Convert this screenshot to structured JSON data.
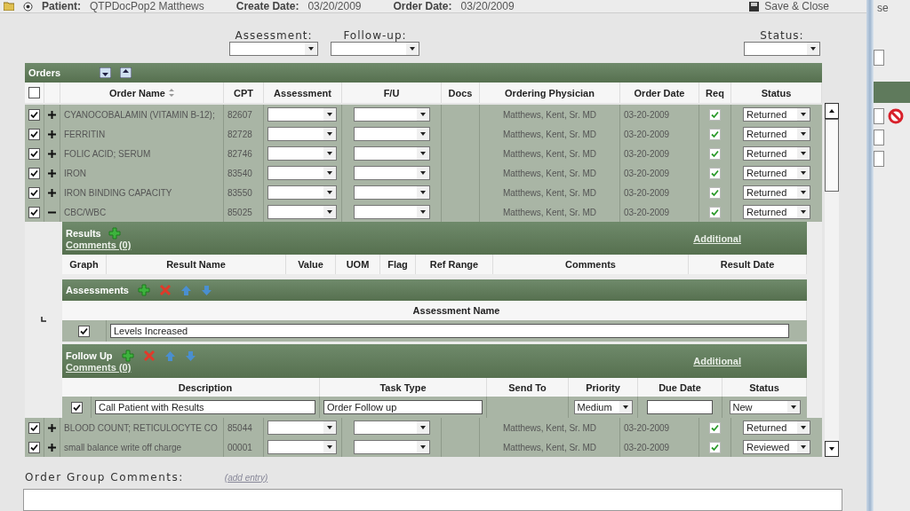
{
  "header": {
    "patient_label": "Patient:",
    "patient": "QTPDocPop2 Matthews",
    "create_date_label": "Create Date:",
    "create_date": "03/20/2009",
    "order_date_label": "Order Date:",
    "order_date": "03/20/2009",
    "save_button": "Save & Close"
  },
  "filters": [
    {
      "label": "Assessment:"
    },
    {
      "label": "Follow-up:"
    },
    {
      "label": "Status:"
    }
  ],
  "orders": {
    "title": "Orders",
    "select_all_checked": false,
    "columns": [
      "Order Name",
      "CPT",
      "Assessment",
      "F/U",
      "Docs",
      "Ordering Physician",
      "Order Date",
      "Req",
      "Status"
    ],
    "rows": [
      {
        "checked": true,
        "expanded": false,
        "name": "CYANOCOBALAMIN (VITAMIN B-12);",
        "cpt": "82607",
        "physician": "Matthews, Kent, Sr. MD",
        "order_date": "03-20-2009",
        "required": true,
        "status": "Returned"
      },
      {
        "checked": true,
        "expanded": false,
        "name": "FERRITIN",
        "cpt": "82728",
        "physician": "Matthews, Kent, Sr. MD",
        "order_date": "03-20-2009",
        "required": true,
        "status": "Returned"
      },
      {
        "checked": true,
        "expanded": false,
        "name": "FOLIC ACID; SERUM",
        "cpt": "82746",
        "physician": "Matthews, Kent, Sr. MD",
        "order_date": "03-20-2009",
        "required": true,
        "status": "Returned"
      },
      {
        "checked": true,
        "expanded": false,
        "name": "IRON",
        "cpt": "83540",
        "physician": "Matthews, Kent, Sr. MD",
        "order_date": "03-20-2009",
        "required": true,
        "status": "Returned"
      },
      {
        "checked": true,
        "expanded": false,
        "name": "IRON BINDING CAPACITY",
        "cpt": "83550",
        "physician": "Matthews, Kent, Sr. MD",
        "order_date": "03-20-2009",
        "required": true,
        "status": "Returned"
      },
      {
        "checked": true,
        "expanded": true,
        "name": "CBC/WBC",
        "cpt": "85025",
        "physician": "Matthews, Kent, Sr. MD",
        "order_date": "03-20-2009",
        "required": true,
        "status": "Returned",
        "detail": {
          "results": {
            "title": "Results",
            "comments_link": "Comments (0)",
            "additional_link": "Additional",
            "columns": [
              "Graph",
              "Result Name",
              "Value",
              "UOM",
              "Flag",
              "Ref Range",
              "Comments",
              "Result Date"
            ]
          },
          "assessments": {
            "title": "Assessments",
            "column": "Assessment Name",
            "rows": [
              {
                "checked": true,
                "name": "Levels Increased"
              }
            ]
          },
          "follow_up": {
            "title": "Follow Up",
            "comments_link": "Comments (0)",
            "additional_link": "Additional",
            "columns": [
              "Description",
              "Task Type",
              "Send To",
              "Priority",
              "Due Date",
              "Status"
            ],
            "rows": [
              {
                "checked": true,
                "description": "Call Patient with Results",
                "task_type": "Order Follow up",
                "priority": "Medium",
                "status": "New"
              }
            ]
          }
        }
      },
      {
        "checked": true,
        "expanded": false,
        "name": "BLOOD COUNT; RETICULOCYTE CO",
        "cpt": "85044",
        "physician": "Matthews, Kent, Sr. MD",
        "order_date": "03-20-2009",
        "required": true,
        "status": "Returned"
      },
      {
        "checked": true,
        "expanded": false,
        "name": "small balance write off charge",
        "cpt": "00001",
        "physician": "Matthews, Kent, Sr. MD",
        "order_date": "03-20-2009",
        "required": true,
        "status": "Reviewed"
      }
    ]
  },
  "comments": {
    "label": "Order Group Comments:",
    "add_link": "(add entry)"
  },
  "side_window": {
    "title_fragment": "se"
  }
}
